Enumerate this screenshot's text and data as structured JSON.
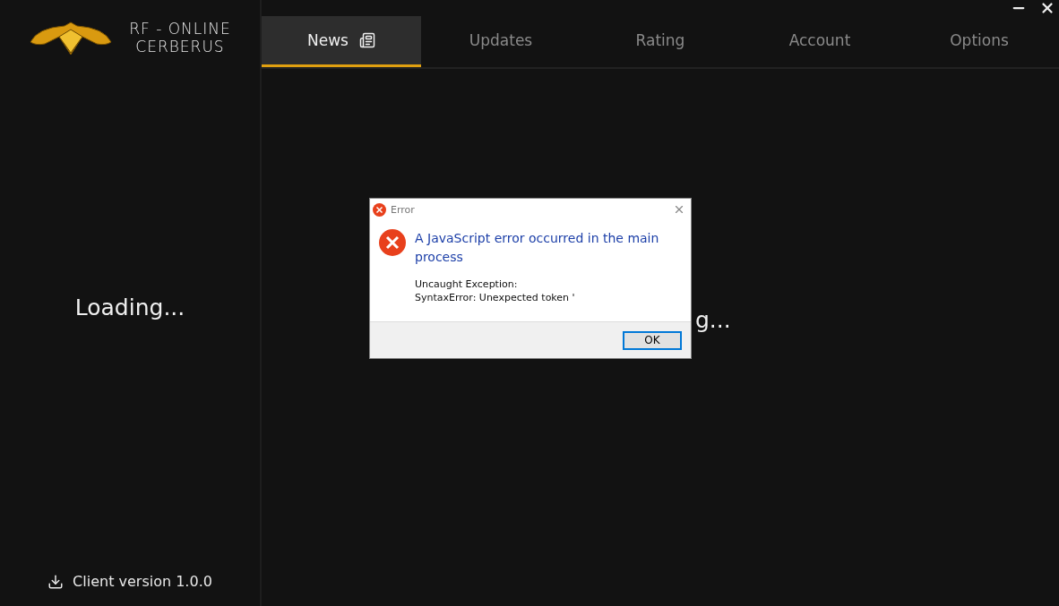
{
  "brand": {
    "line1": "RF - ONLINE",
    "line2": "CERBERUS"
  },
  "tabs": [
    {
      "label": "News",
      "selected": true,
      "kind": "with_icon"
    },
    {
      "label": "Updates",
      "selected": false,
      "kind": "plain"
    },
    {
      "label": "Rating",
      "selected": false,
      "kind": "plain"
    },
    {
      "label": "Account",
      "selected": false,
      "kind": "plain"
    },
    {
      "label": "Options",
      "selected": false,
      "kind": "plain"
    }
  ],
  "sidebar": {
    "loading": "Loading...",
    "version": "Client version 1.0.0"
  },
  "content": {
    "loading_visible": "g..."
  },
  "dialog": {
    "title": "Error",
    "heading": "A JavaScript error occurred in the main process",
    "message_lines": [
      "Uncaught Exception:",
      "SyntaxError: Unexpected token '"
    ],
    "buttons": [
      "OK"
    ]
  }
}
